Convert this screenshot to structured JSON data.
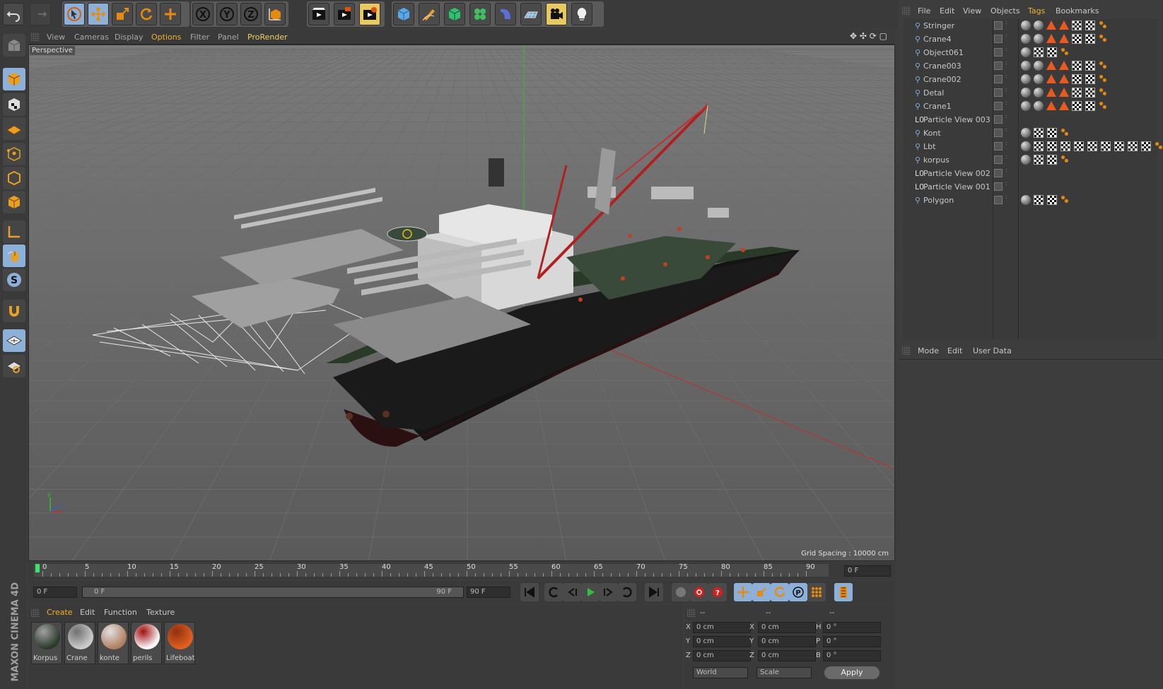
{
  "app": {
    "name": "MAXON CINEMA 4D"
  },
  "toolbar": {
    "icons": [
      "undo-icon",
      "redo-icon",
      "select-icon",
      "move-icon",
      "scale-icon",
      "rotate-icon",
      "add-icon",
      "x-axis-icon",
      "y-axis-icon",
      "z-axis-icon",
      "coord-system-icon",
      "render-view-icon",
      "render-picture-viewer-icon",
      "render-settings-icon",
      "cube-icon",
      "pen-icon",
      "subdivision-icon",
      "cloner-icon",
      "deformer-icon",
      "floor-icon",
      "camera-icon",
      "light-icon"
    ],
    "axis_labels": [
      "X",
      "Y",
      "Z"
    ]
  },
  "viewport": {
    "menu": [
      "View",
      "Cameras",
      "Display",
      "Options",
      "Filter",
      "Panel",
      "ProRender"
    ],
    "active_menu": "Options",
    "highlight_menu": "ProRender",
    "camera_label": "Perspective",
    "grid_spacing": "Grid Spacing : 10000 cm"
  },
  "object_manager": {
    "menu": [
      "File",
      "Edit",
      "View",
      "Objects",
      "Tags",
      "Bookmarks"
    ],
    "active_menu": "Tags",
    "objects": [
      {
        "name": "Stringer",
        "type": "null",
        "tags": "mat2-warn2-check2-dot"
      },
      {
        "name": "Crane4",
        "type": "null",
        "tags": "mat2-warn2-check2-dot"
      },
      {
        "name": "Object061",
        "type": "null",
        "tags": "mat1-check2-dot"
      },
      {
        "name": "Crane003",
        "type": "null",
        "tags": "mat2-warn2-check2-dot"
      },
      {
        "name": "Crane002",
        "type": "null",
        "tags": "mat2-warn2-check2-dot"
      },
      {
        "name": "Detal",
        "type": "null",
        "tags": "mat2-warn2-check2-dot"
      },
      {
        "name": "Crane1",
        "type": "null",
        "tags": "mat2-warn2-check2-dot"
      },
      {
        "name": "Particle View 003",
        "type": "particle",
        "tags": ""
      },
      {
        "name": "Kont",
        "type": "null",
        "tags": "mat1-check2-dot"
      },
      {
        "name": "Lbt",
        "type": "null",
        "tags": "mat1-check9-dot"
      },
      {
        "name": "korpus",
        "type": "null",
        "tags": "mat1-check2-dot"
      },
      {
        "name": "Particle View 002",
        "type": "particle",
        "tags": ""
      },
      {
        "name": "Particle View 001",
        "type": "particle",
        "tags": ""
      },
      {
        "name": "Polygon",
        "type": "null",
        "tags": "mat1-check2-dot"
      }
    ]
  },
  "attribute_manager": {
    "menu": [
      "Mode",
      "Edit",
      "User Data"
    ]
  },
  "timeline": {
    "ticks": [
      "0",
      "5",
      "10",
      "15",
      "20",
      "25",
      "30",
      "35",
      "40",
      "45",
      "50",
      "55",
      "60",
      "65",
      "70",
      "75",
      "80",
      "85",
      "90"
    ],
    "current_frame_field": "0 F"
  },
  "transport": {
    "start_field": "0 F",
    "range_start": "0 F",
    "range_end": "90 F",
    "end_field": "90 F"
  },
  "material_manager": {
    "menu": [
      "Create",
      "Edit",
      "Function",
      "Texture"
    ],
    "active_menu": "Create",
    "materials": [
      {
        "name": "Korpus",
        "c1": "#2a3a2a",
        "c2": "#a0a0a0"
      },
      {
        "name": "Crane",
        "c1": "#cccccc",
        "c2": "#707070"
      },
      {
        "name": "konte",
        "c1": "#b08060",
        "c2": "#e0e0e0"
      },
      {
        "name": "perils",
        "c1": "#ffffff",
        "c2": "#a01010"
      },
      {
        "name": "Lifeboat",
        "c1": "#e06020",
        "c2": "#903010"
      }
    ]
  },
  "coordinates": {
    "headers": [
      "--",
      "--",
      "--"
    ],
    "rows": [
      {
        "l1": "X",
        "v1": "0 cm",
        "l2": "X",
        "v2": "0 cm",
        "l3": "H",
        "v3": "0 °"
      },
      {
        "l1": "Y",
        "v1": "0 cm",
        "l2": "Y",
        "v2": "0 cm",
        "l3": "P",
        "v3": "0 °"
      },
      {
        "l1": "Z",
        "v1": "0 cm",
        "l2": "Z",
        "v2": "0 cm",
        "l3": "B",
        "v3": "0 °"
      }
    ],
    "mode_select": "World",
    "size_select": "Scale",
    "apply_label": "Apply"
  },
  "colors": {
    "accent": "#e8c860",
    "active_tab": "#f0b030",
    "highlight_menu": "#f0d060",
    "timeline_marker": "#40e070"
  }
}
